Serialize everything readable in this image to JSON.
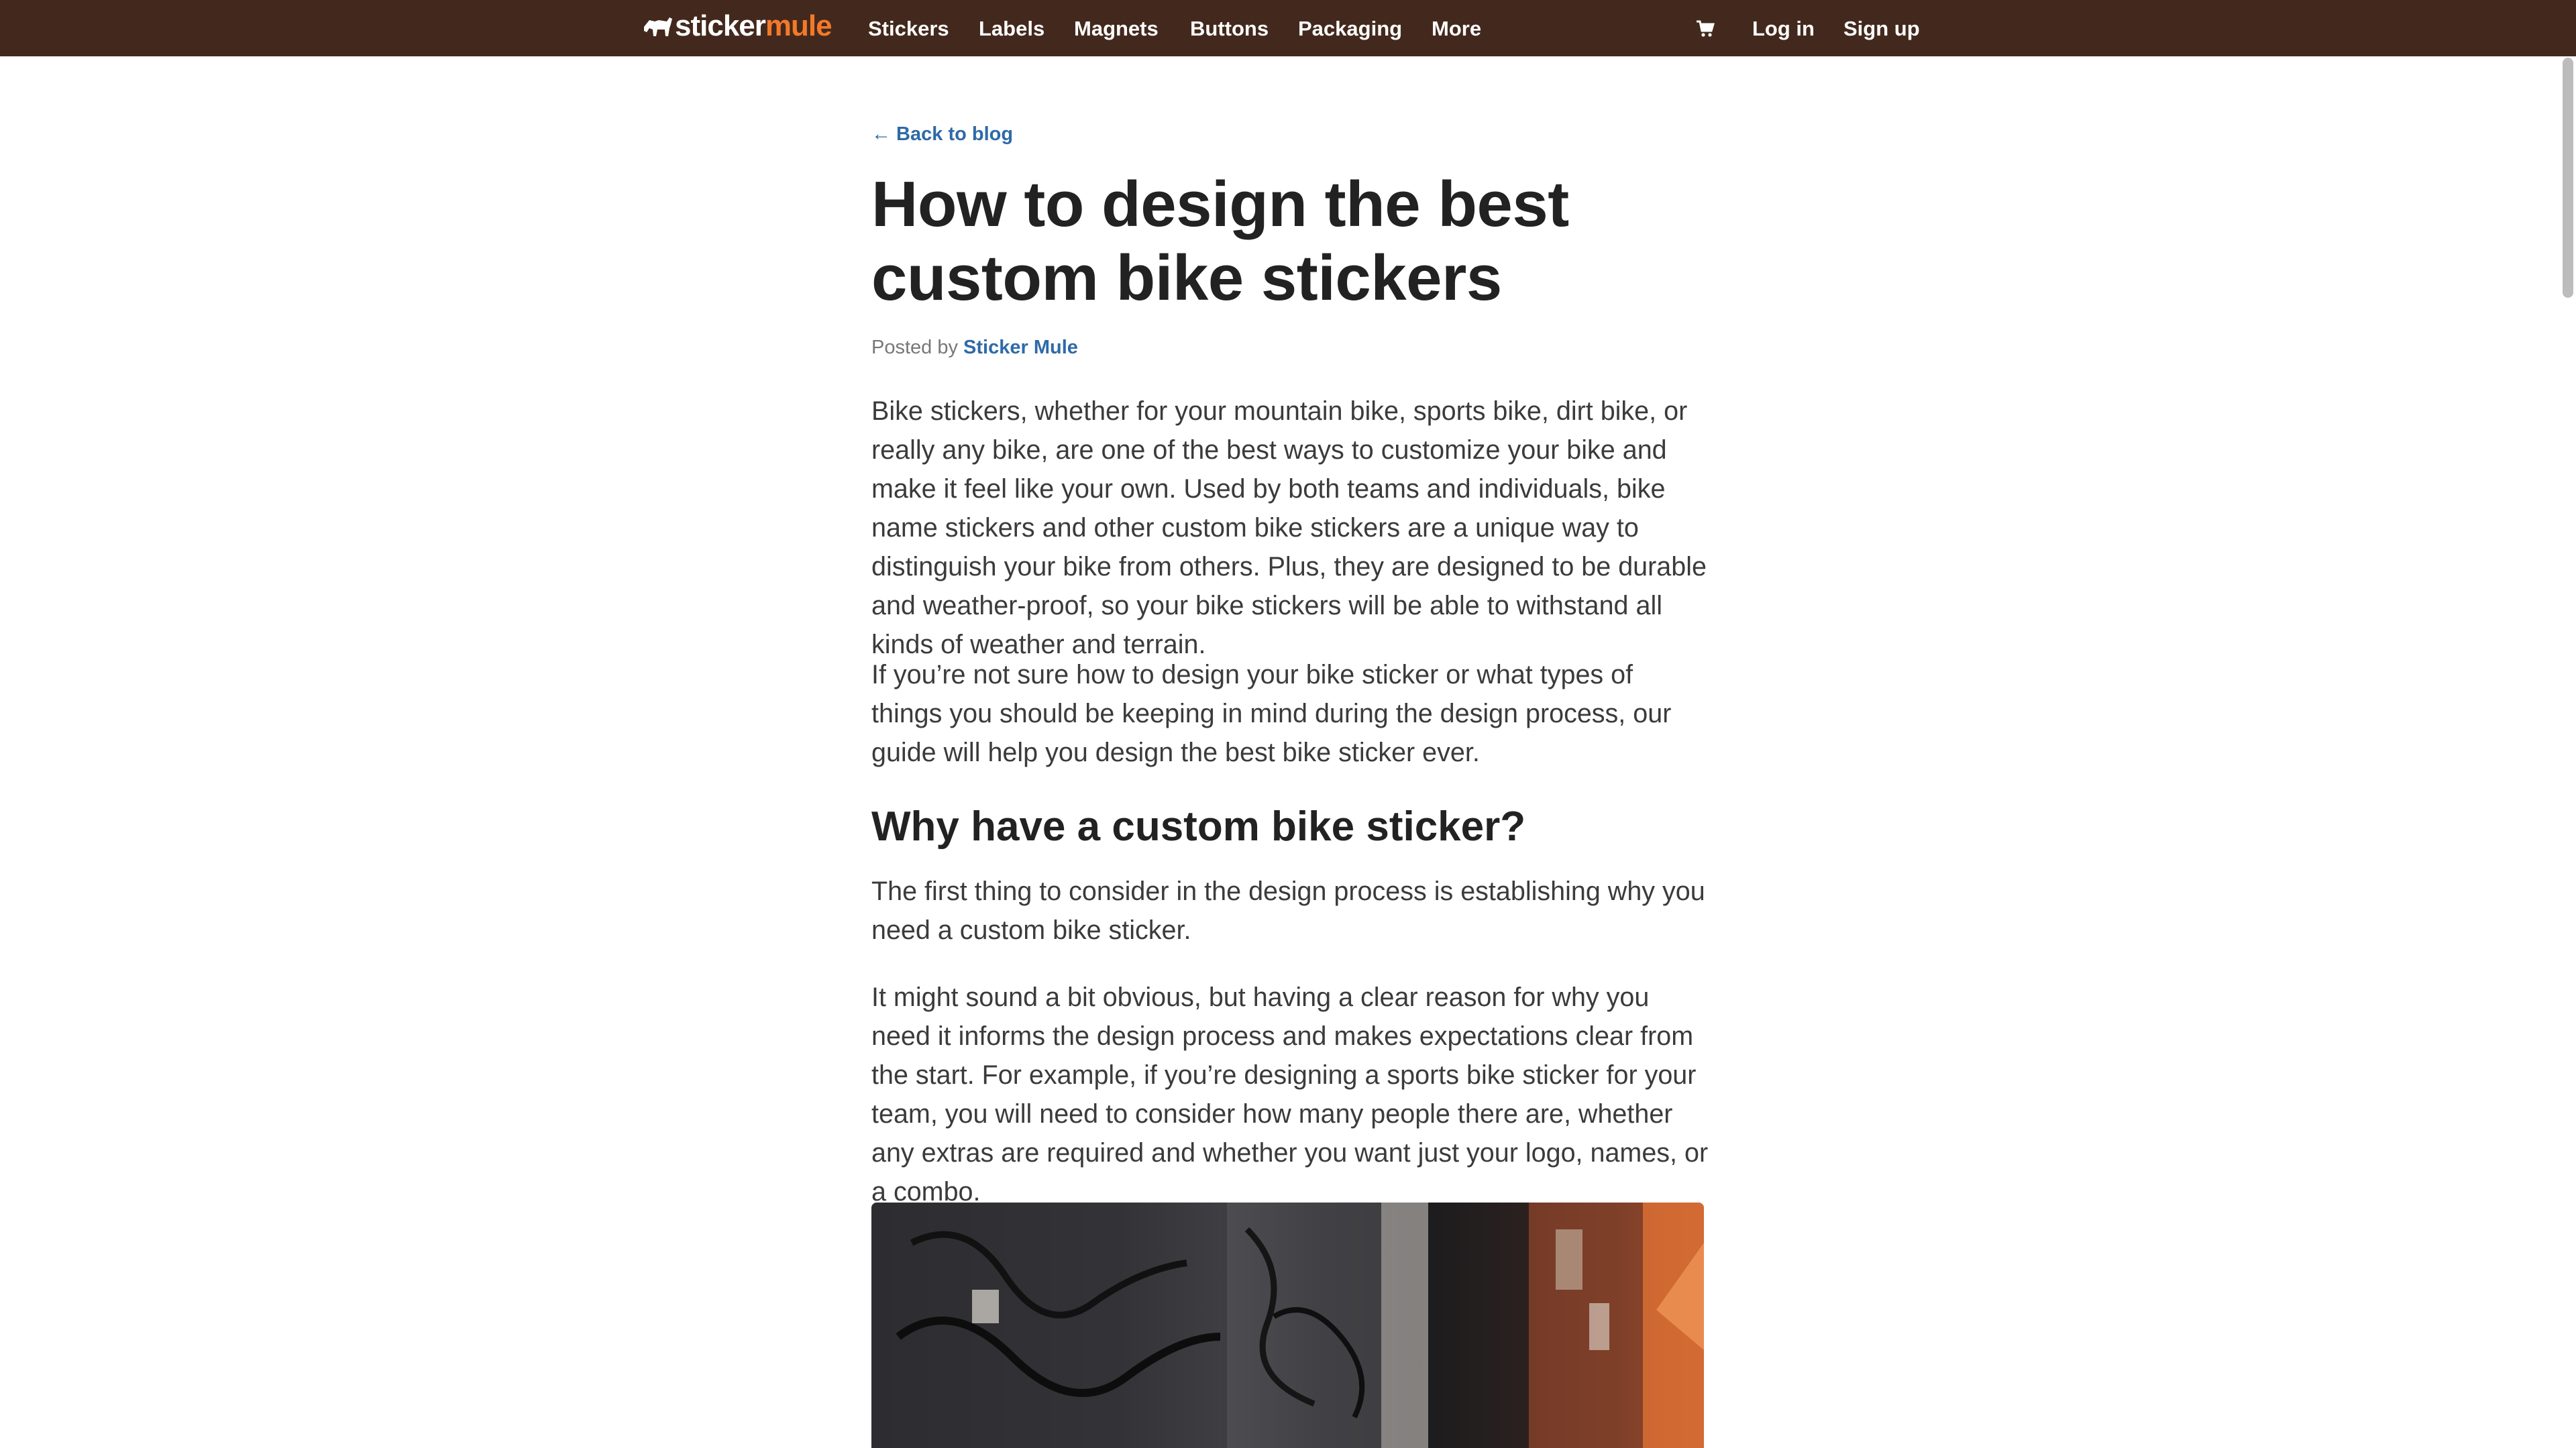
{
  "nav": {
    "logo": {
      "part1": "sticker",
      "part2": "mule"
    },
    "items": [
      "Stickers",
      "Labels",
      "Magnets",
      "Buttons",
      "Packaging",
      "More"
    ],
    "login": "Log in",
    "signup": "Sign up"
  },
  "article": {
    "back_link": "← Back to blog",
    "title": "How to design the best custom bike stickers",
    "byline_prefix": "Posted by",
    "author": "Sticker Mule",
    "paragraphs": [
      "Bike stickers, whether for your mountain bike, sports bike, dirt bike, or really any bike, are one of the best ways to customize your bike and make it feel like your own. Used by both teams and individuals, bike name stickers and other custom bike stickers are a unique way to distinguish your bike from others. Plus, they are designed to be durable and weather-proof, so your bike stickers will be able to withstand all kinds of weather and terrain.",
      "If you’re not sure how to design your bike sticker or what types of things you should be keeping in mind during the design process, our guide will help you design the best bike sticker ever."
    ],
    "section_heading": "Why have a custom bike sticker?",
    "section_paragraphs": [
      "The first thing to consider in the design process is establishing why you need a custom bike sticker.",
      "It might sound a bit obvious, but having a clear reason for why you need it informs the design process and makes expectations clear from the start. For example, if you’re designing a sports bike sticker for your team, you will need to consider how many people there are, whether any extras are required and whether you want just your logo, names, or a combo."
    ]
  },
  "colors": {
    "nav_bg": "#43291d",
    "logo_accent": "#f3792a",
    "link": "#2e6aa8"
  },
  "icons": {
    "logo": "mule-icon",
    "cart": "cart-icon"
  }
}
